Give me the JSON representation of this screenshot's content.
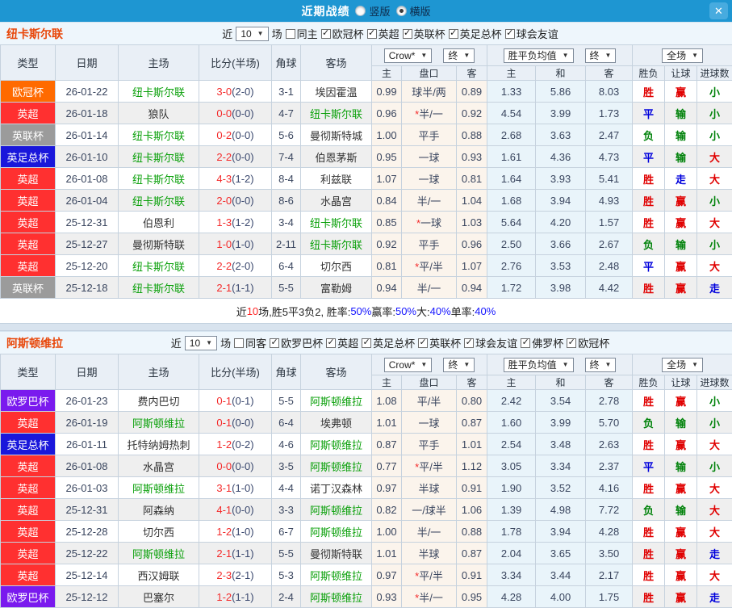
{
  "titlebar": {
    "title": "近期战绩",
    "vertical_label": "竖版",
    "horizontal_label": "横版",
    "vertical_checked": false,
    "horizontal_checked": true
  },
  "icons": {
    "close": "✕",
    "caret": "▼",
    "check": "✓"
  },
  "colors": {
    "titlebar_bg": "#1E96D2",
    "team_name": "#E8470A",
    "highlight_team": "#0AA00A",
    "score": "#F42A2A",
    "half_score": "#3A486E",
    "league_badges": {
      "欧冠杯": "#FF6A00",
      "英超": "#FF3030",
      "英联杯": "#9B9B9B",
      "英足总杯": "#1A17DB",
      "欧罗巴杯": "#7A1AEE"
    }
  },
  "table_headers": {
    "left": [
      "类型",
      "日期",
      "主场",
      "比分(半场)",
      "角球",
      "客场"
    ],
    "odds_dropdown": "Crow*",
    "odds_final_dropdown": "终",
    "avg_dropdown": "胜平负均值",
    "avg_final_dropdown": "终",
    "full_dropdown": "全场",
    "odds_sub": [
      "主",
      "盘口",
      "客"
    ],
    "avg_sub": [
      "主",
      "和",
      "客"
    ],
    "result_sub": [
      "胜负",
      "让球",
      "进球数"
    ]
  },
  "filter_labels": {
    "near": "近",
    "count": "10",
    "games": "场"
  },
  "sections": [
    {
      "team": "纽卡斯尔联",
      "same_label": "同主",
      "leagues": [
        "欧冠杯",
        "英超",
        "英联杯",
        "英足总杯",
        "球会友谊"
      ],
      "rows": [
        {
          "league": "欧冠杯",
          "date": "26-01-22",
          "home": "纽卡斯尔联",
          "home_hl": true,
          "score": "3-0",
          "half": "(2-0)",
          "corners": "3-1",
          "away": "埃因霍温",
          "away_hl": false,
          "odds": [
            "0.99",
            "球半/两",
            "0.89"
          ],
          "avg": [
            "1.33",
            "5.86",
            "8.03"
          ],
          "results": [
            [
              "胜",
              "r"
            ],
            [
              "赢",
              "r"
            ],
            [
              "小",
              "g"
            ]
          ]
        },
        {
          "league": "英超",
          "date": "26-01-18",
          "home": "狼队",
          "home_hl": false,
          "score": "0-0",
          "half": "(0-0)",
          "corners": "4-7",
          "away": "纽卡斯尔联",
          "away_hl": true,
          "odds": [
            "0.96",
            "*半/一",
            "0.92"
          ],
          "avg": [
            "4.54",
            "3.99",
            "1.73"
          ],
          "results": [
            [
              "平",
              "b"
            ],
            [
              "输",
              "g"
            ],
            [
              "小",
              "g"
            ]
          ]
        },
        {
          "league": "英联杯",
          "date": "26-01-14",
          "home": "纽卡斯尔联",
          "home_hl": true,
          "score": "0-2",
          "half": "(0-0)",
          "corners": "5-6",
          "away": "曼彻斯特城",
          "away_hl": false,
          "odds": [
            "1.00",
            "平手",
            "0.88"
          ],
          "avg": [
            "2.68",
            "3.63",
            "2.47"
          ],
          "results": [
            [
              "负",
              "g"
            ],
            [
              "输",
              "g"
            ],
            [
              "小",
              "g"
            ]
          ]
        },
        {
          "league": "英足总杯",
          "date": "26-01-10",
          "home": "纽卡斯尔联",
          "home_hl": true,
          "score": "2-2",
          "half": "(0-0)",
          "corners": "7-4",
          "away": "伯恩茅斯",
          "away_hl": false,
          "odds": [
            "0.95",
            "一球",
            "0.93"
          ],
          "avg": [
            "1.61",
            "4.36",
            "4.73"
          ],
          "results": [
            [
              "平",
              "b"
            ],
            [
              "输",
              "g"
            ],
            [
              "大",
              "r"
            ]
          ]
        },
        {
          "league": "英超",
          "date": "26-01-08",
          "home": "纽卡斯尔联",
          "home_hl": true,
          "score": "4-3",
          "half": "(1-2)",
          "corners": "8-4",
          "away": "利兹联",
          "away_hl": false,
          "odds": [
            "1.07",
            "一球",
            "0.81"
          ],
          "avg": [
            "1.64",
            "3.93",
            "5.41"
          ],
          "results": [
            [
              "胜",
              "r"
            ],
            [
              "走",
              "b"
            ],
            [
              "大",
              "r"
            ]
          ]
        },
        {
          "league": "英超",
          "date": "26-01-04",
          "home": "纽卡斯尔联",
          "home_hl": true,
          "score": "2-0",
          "half": "(0-0)",
          "corners": "8-6",
          "away": "水晶宫",
          "away_hl": false,
          "odds": [
            "0.84",
            "半/一",
            "1.04"
          ],
          "avg": [
            "1.68",
            "3.94",
            "4.93"
          ],
          "results": [
            [
              "胜",
              "r"
            ],
            [
              "赢",
              "r"
            ],
            [
              "小",
              "g"
            ]
          ]
        },
        {
          "league": "英超",
          "date": "25-12-31",
          "home": "伯恩利",
          "home_hl": false,
          "score": "1-3",
          "half": "(1-2)",
          "corners": "3-4",
          "away": "纽卡斯尔联",
          "away_hl": true,
          "odds": [
            "0.85",
            "*一球",
            "1.03"
          ],
          "avg": [
            "5.64",
            "4.20",
            "1.57"
          ],
          "results": [
            [
              "胜",
              "r"
            ],
            [
              "赢",
              "r"
            ],
            [
              "大",
              "r"
            ]
          ]
        },
        {
          "league": "英超",
          "date": "25-12-27",
          "home": "曼彻斯特联",
          "home_hl": false,
          "score": "1-0",
          "half": "(1-0)",
          "corners": "2-11",
          "away": "纽卡斯尔联",
          "away_hl": true,
          "odds": [
            "0.92",
            "平手",
            "0.96"
          ],
          "avg": [
            "2.50",
            "3.66",
            "2.67"
          ],
          "results": [
            [
              "负",
              "g"
            ],
            [
              "输",
              "g"
            ],
            [
              "小",
              "g"
            ]
          ]
        },
        {
          "league": "英超",
          "date": "25-12-20",
          "home": "纽卡斯尔联",
          "home_hl": true,
          "score": "2-2",
          "half": "(2-0)",
          "corners": "6-4",
          "away": "切尔西",
          "away_hl": false,
          "odds": [
            "0.81",
            "*平/半",
            "1.07"
          ],
          "avg": [
            "2.76",
            "3.53",
            "2.48"
          ],
          "results": [
            [
              "平",
              "b"
            ],
            [
              "赢",
              "r"
            ],
            [
              "大",
              "r"
            ]
          ]
        },
        {
          "league": "英联杯",
          "date": "25-12-18",
          "home": "纽卡斯尔联",
          "home_hl": true,
          "score": "2-1",
          "half": "(1-1)",
          "corners": "5-5",
          "away": "富勒姆",
          "away_hl": false,
          "odds": [
            "0.94",
            "半/一",
            "0.94"
          ],
          "avg": [
            "1.72",
            "3.98",
            "4.42"
          ],
          "results": [
            [
              "胜",
              "r"
            ],
            [
              "赢",
              "r"
            ],
            [
              "走",
              "b"
            ]
          ]
        }
      ],
      "summary_parts": [
        {
          "t": "近",
          "c": "k"
        },
        {
          "t": "10",
          "c": "r"
        },
        {
          "t": "场,胜5平3负2, 胜率:",
          "c": "k"
        },
        {
          "t": "50%",
          "c": "b"
        },
        {
          "t": " 赢率:",
          "c": "k"
        },
        {
          "t": "50%",
          "c": "b"
        },
        {
          "t": " 大:",
          "c": "k"
        },
        {
          "t": "40%",
          "c": "b"
        },
        {
          "t": " 单率:",
          "c": "k"
        },
        {
          "t": "40%",
          "c": "b"
        }
      ]
    },
    {
      "team": "阿斯顿维拉",
      "same_label": "同客",
      "leagues": [
        "欧罗巴杯",
        "英超",
        "英足总杯",
        "英联杯",
        "球会友谊",
        "佛罗杯",
        "欧冠杯"
      ],
      "rows": [
        {
          "league": "欧罗巴杯",
          "date": "26-01-23",
          "home": "费内巴切",
          "home_hl": false,
          "score": "0-1",
          "half": "(0-1)",
          "corners": "5-5",
          "away": "阿斯顿维拉",
          "away_hl": true,
          "odds": [
            "1.08",
            "平/半",
            "0.80"
          ],
          "avg": [
            "2.42",
            "3.54",
            "2.78"
          ],
          "results": [
            [
              "胜",
              "r"
            ],
            [
              "赢",
              "r"
            ],
            [
              "小",
              "g"
            ]
          ]
        },
        {
          "league": "英超",
          "date": "26-01-19",
          "home": "阿斯顿维拉",
          "home_hl": true,
          "score": "0-1",
          "half": "(0-0)",
          "corners": "6-4",
          "away": "埃弗顿",
          "away_hl": false,
          "odds": [
            "1.01",
            "一球",
            "0.87"
          ],
          "avg": [
            "1.60",
            "3.99",
            "5.70"
          ],
          "results": [
            [
              "负",
              "g"
            ],
            [
              "输",
              "g"
            ],
            [
              "小",
              "g"
            ]
          ]
        },
        {
          "league": "英足总杯",
          "date": "26-01-11",
          "home": "托特纳姆热刺",
          "home_hl": false,
          "score": "1-2",
          "half": "(0-2)",
          "corners": "4-6",
          "away": "阿斯顿维拉",
          "away_hl": true,
          "odds": [
            "0.87",
            "平手",
            "1.01"
          ],
          "avg": [
            "2.54",
            "3.48",
            "2.63"
          ],
          "results": [
            [
              "胜",
              "r"
            ],
            [
              "赢",
              "r"
            ],
            [
              "大",
              "r"
            ]
          ]
        },
        {
          "league": "英超",
          "date": "26-01-08",
          "home": "水晶宫",
          "home_hl": false,
          "score": "0-0",
          "half": "(0-0)",
          "corners": "3-5",
          "away": "阿斯顿维拉",
          "away_hl": true,
          "odds": [
            "0.77",
            "*平/半",
            "1.12"
          ],
          "avg": [
            "3.05",
            "3.34",
            "2.37"
          ],
          "results": [
            [
              "平",
              "b"
            ],
            [
              "输",
              "g"
            ],
            [
              "小",
              "g"
            ]
          ]
        },
        {
          "league": "英超",
          "date": "26-01-03",
          "home": "阿斯顿维拉",
          "home_hl": true,
          "score": "3-1",
          "half": "(1-0)",
          "corners": "4-4",
          "away": "诺丁汉森林",
          "away_hl": false,
          "odds": [
            "0.97",
            "半球",
            "0.91"
          ],
          "avg": [
            "1.90",
            "3.52",
            "4.16"
          ],
          "results": [
            [
              "胜",
              "r"
            ],
            [
              "赢",
              "r"
            ],
            [
              "大",
              "r"
            ]
          ]
        },
        {
          "league": "英超",
          "date": "25-12-31",
          "home": "阿森纳",
          "home_hl": false,
          "score": "4-1",
          "half": "(0-0)",
          "corners": "3-3",
          "away": "阿斯顿维拉",
          "away_hl": true,
          "odds": [
            "0.82",
            "一/球半",
            "1.06"
          ],
          "avg": [
            "1.39",
            "4.98",
            "7.72"
          ],
          "results": [
            [
              "负",
              "g"
            ],
            [
              "输",
              "g"
            ],
            [
              "大",
              "r"
            ]
          ]
        },
        {
          "league": "英超",
          "date": "25-12-28",
          "home": "切尔西",
          "home_hl": false,
          "score": "1-2",
          "half": "(1-0)",
          "corners": "6-7",
          "away": "阿斯顿维拉",
          "away_hl": true,
          "odds": [
            "1.00",
            "半/一",
            "0.88"
          ],
          "avg": [
            "1.78",
            "3.94",
            "4.28"
          ],
          "results": [
            [
              "胜",
              "r"
            ],
            [
              "赢",
              "r"
            ],
            [
              "大",
              "r"
            ]
          ]
        },
        {
          "league": "英超",
          "date": "25-12-22",
          "home": "阿斯顿维拉",
          "home_hl": true,
          "score": "2-1",
          "half": "(1-1)",
          "corners": "5-5",
          "away": "曼彻斯特联",
          "away_hl": false,
          "odds": [
            "1.01",
            "半球",
            "0.87"
          ],
          "avg": [
            "2.04",
            "3.65",
            "3.50"
          ],
          "results": [
            [
              "胜",
              "r"
            ],
            [
              "赢",
              "r"
            ],
            [
              "走",
              "b"
            ]
          ]
        },
        {
          "league": "英超",
          "date": "25-12-14",
          "home": "西汉姆联",
          "home_hl": false,
          "score": "2-3",
          "half": "(2-1)",
          "corners": "5-3",
          "away": "阿斯顿维拉",
          "away_hl": true,
          "odds": [
            "0.97",
            "*平/半",
            "0.91"
          ],
          "avg": [
            "3.34",
            "3.44",
            "2.17"
          ],
          "results": [
            [
              "胜",
              "r"
            ],
            [
              "赢",
              "r"
            ],
            [
              "大",
              "r"
            ]
          ]
        },
        {
          "league": "欧罗巴杯",
          "date": "25-12-12",
          "home": "巴塞尔",
          "home_hl": false,
          "score": "1-2",
          "half": "(1-1)",
          "corners": "2-4",
          "away": "阿斯顿维拉",
          "away_hl": true,
          "odds": [
            "0.93",
            "*半/一",
            "0.95"
          ],
          "avg": [
            "4.28",
            "4.00",
            "1.75"
          ],
          "results": [
            [
              "胜",
              "r"
            ],
            [
              "赢",
              "r"
            ],
            [
              "走",
              "b"
            ]
          ]
        }
      ]
    }
  ]
}
